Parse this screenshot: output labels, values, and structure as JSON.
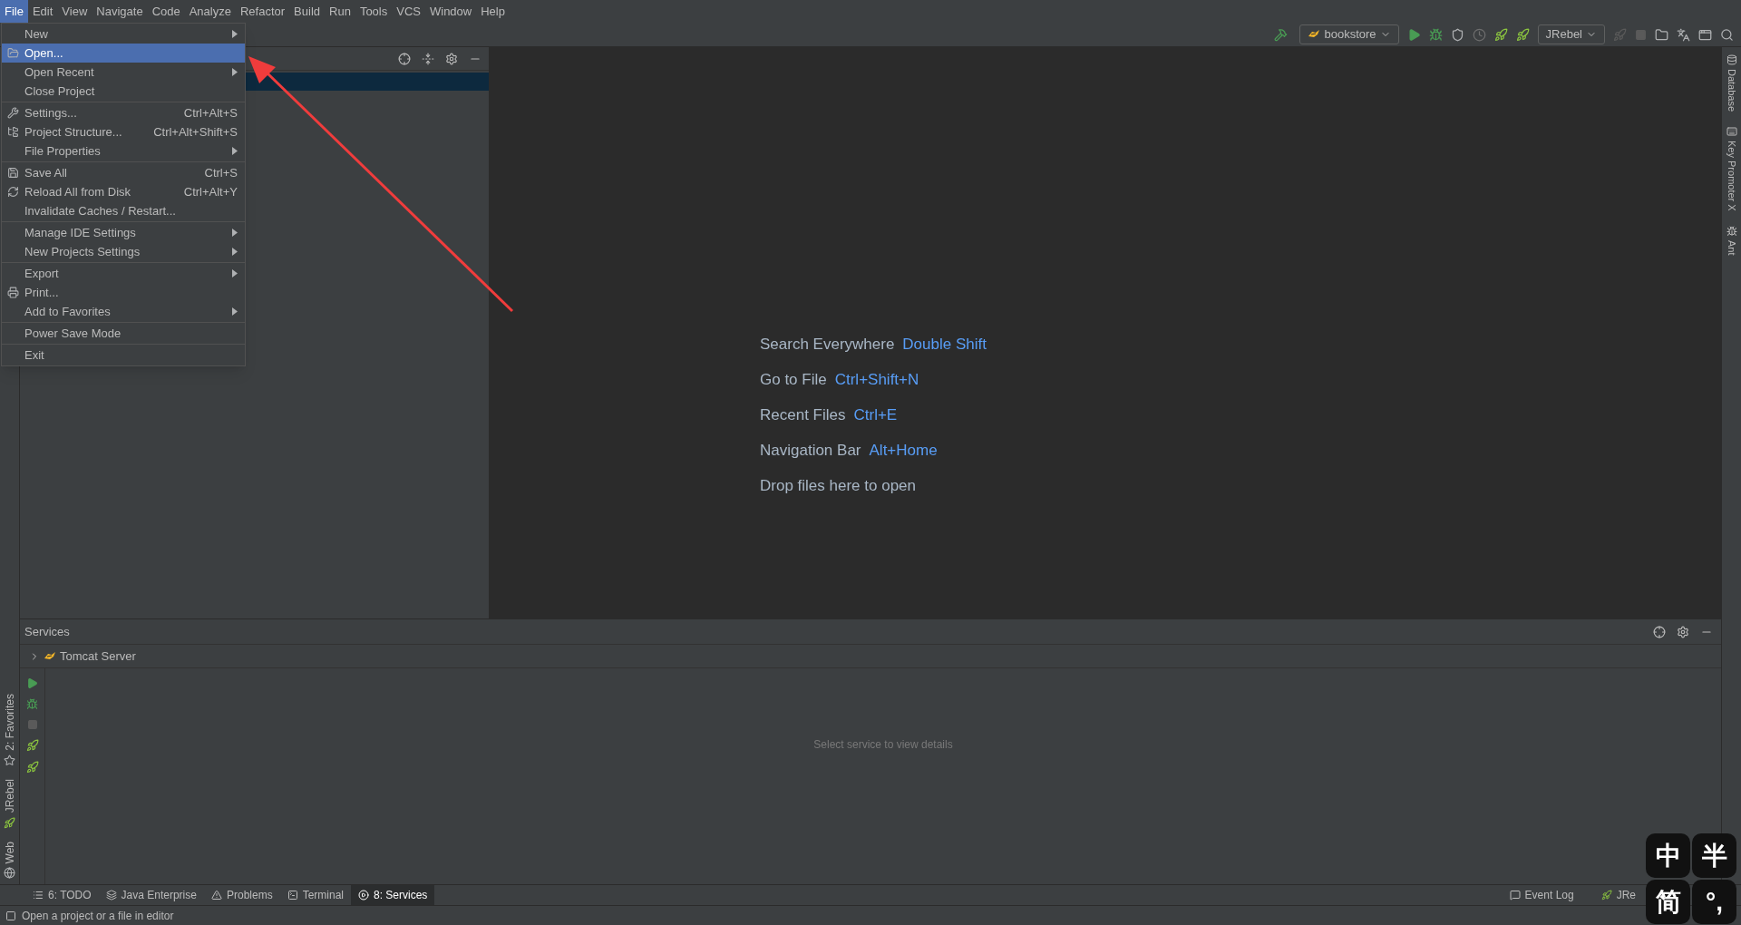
{
  "menu_bar": [
    {
      "label": "File",
      "selected": true
    },
    {
      "label": "Edit",
      "selected": false
    },
    {
      "label": "View",
      "selected": false
    },
    {
      "label": "Navigate",
      "selected": false
    },
    {
      "label": "Code",
      "selected": false
    },
    {
      "label": "Analyze",
      "selected": false
    },
    {
      "label": "Refactor",
      "selected": false
    },
    {
      "label": "Build",
      "selected": false
    },
    {
      "label": "Run",
      "selected": false
    },
    {
      "label": "Tools",
      "selected": false
    },
    {
      "label": "VCS",
      "selected": false
    },
    {
      "label": "Window",
      "selected": false
    },
    {
      "label": "Help",
      "selected": false
    }
  ],
  "toolbar": {
    "run_config": "bookstore",
    "jrebel_config": "JRebel"
  },
  "file_menu": {
    "sections": [
      [
        {
          "label": "New",
          "submenu": true,
          "selected": false
        },
        {
          "label": "Open...",
          "submenu": false,
          "selected": true
        },
        {
          "label": "Open Recent",
          "submenu": true,
          "selected": false
        },
        {
          "label": "Close Project",
          "submenu": false,
          "selected": false
        }
      ],
      [
        {
          "label": "Settings...",
          "shortcut": "Ctrl+Alt+S",
          "submenu": false,
          "selected": false
        },
        {
          "label": "Project Structure...",
          "shortcut": "Ctrl+Alt+Shift+S",
          "submenu": false,
          "selected": false
        },
        {
          "label": "File Properties",
          "submenu": true,
          "selected": false
        }
      ],
      [
        {
          "label": "Save All",
          "shortcut": "Ctrl+S",
          "submenu": false,
          "selected": false
        },
        {
          "label": "Reload All from Disk",
          "shortcut": "Ctrl+Alt+Y",
          "submenu": false,
          "selected": false
        },
        {
          "label": "Invalidate Caches / Restart...",
          "submenu": false,
          "selected": false
        }
      ],
      [
        {
          "label": "Manage IDE Settings",
          "submenu": true,
          "selected": false
        },
        {
          "label": "New Projects Settings",
          "submenu": true,
          "selected": false
        }
      ],
      [
        {
          "label": "Export",
          "submenu": true,
          "selected": false
        },
        {
          "label": "Print...",
          "submenu": false,
          "selected": false
        },
        {
          "label": "Add to Favorites",
          "submenu": true,
          "selected": false
        }
      ],
      [
        {
          "label": "Power Save Mode",
          "submenu": false,
          "selected": false
        }
      ],
      [
        {
          "label": "Exit",
          "submenu": false,
          "selected": false
        }
      ]
    ]
  },
  "editor_hints": [
    {
      "text": "Search Everywhere",
      "shortcut": "Double Shift"
    },
    {
      "text": "Go to File",
      "shortcut": "Ctrl+Shift+N"
    },
    {
      "text": "Recent Files",
      "shortcut": "Ctrl+E"
    },
    {
      "text": "Navigation Bar",
      "shortcut": "Alt+Home"
    },
    {
      "text": "Drop files here to open"
    }
  ],
  "right_stripe": [
    "Database",
    "Key Promoter X",
    "Ant"
  ],
  "left_stripe": [
    "2: Favorites",
    "JRebel",
    "Web"
  ],
  "services": {
    "title": "Services",
    "tree": [
      {
        "label": "Tomcat Server",
        "expanded": false
      }
    ],
    "empty_text": "Select service to view details"
  },
  "bottom_tabs": [
    {
      "label": "6: TODO",
      "selected": false
    },
    {
      "label": "Java Enterprise",
      "selected": false
    },
    {
      "label": "Problems",
      "selected": false
    },
    {
      "label": "Terminal",
      "selected": false
    },
    {
      "label": "8: Services",
      "selected": true
    }
  ],
  "bottom_right_tabs": [
    "Event Log",
    "JRe"
  ],
  "status_bar": {
    "message": "Open a project or a file in editor"
  },
  "ime_toolbar": [
    "中",
    "半",
    "简",
    "°,"
  ]
}
